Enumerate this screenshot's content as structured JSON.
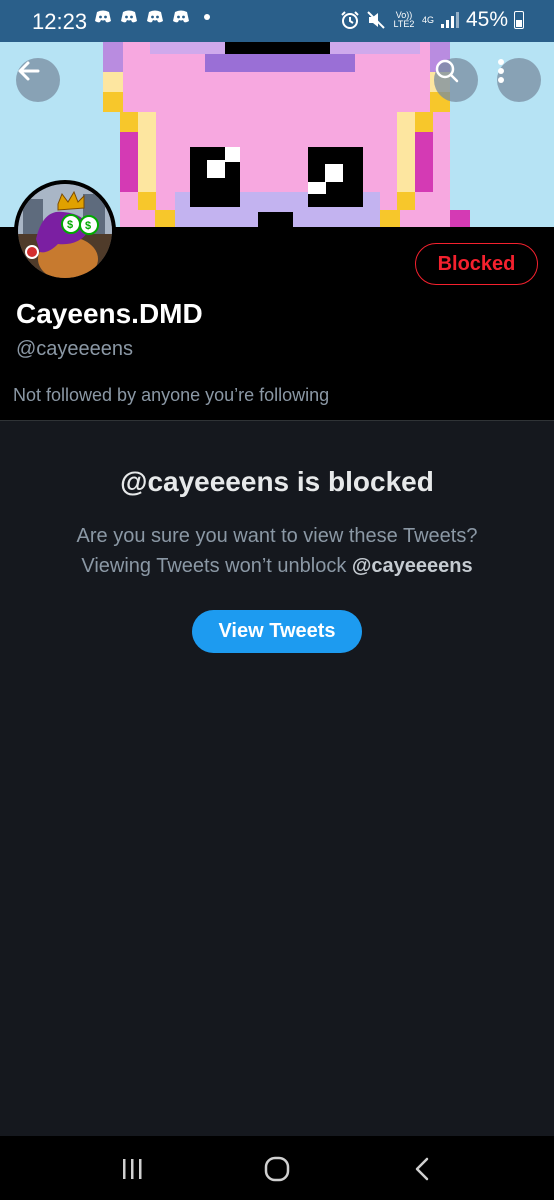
{
  "status_bar": {
    "time": "12:23",
    "volte": "Vo)) LTE2",
    "network": "4G",
    "battery": "45%"
  },
  "header": {
    "back_icon": "arrow-left-icon",
    "search_icon": "search-icon",
    "more_icon": "more-vertical-icon"
  },
  "profile": {
    "display_name": "Cayeens.DMD",
    "handle": "@cayeeeens",
    "followers_note": "Not followed by anyone you’re following",
    "blocked_label": "Blocked"
  },
  "blocked_notice": {
    "title": "@cayeeeens is blocked",
    "line1": "Are you sure you want to view these Tweets?",
    "line2_prefix": "Viewing Tweets won’t unblock ",
    "line2_handle": "@cayeeeens",
    "button_label": "View Tweets"
  },
  "colors": {
    "accent": "#1d9bf0",
    "blocked_red": "#f4212e",
    "status_bar": "#2a5f8a"
  },
  "nav": {
    "recents_icon": "recents-icon",
    "home_icon": "home-icon",
    "back_icon": "back-chevron-icon"
  }
}
